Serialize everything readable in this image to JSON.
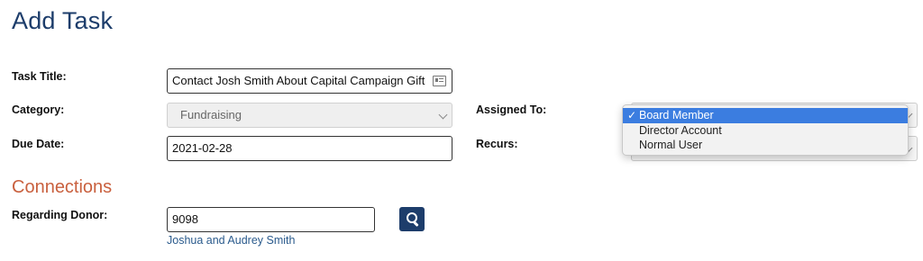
{
  "page": {
    "title": "Add Task"
  },
  "form": {
    "task_title": {
      "label": "Task Title:",
      "value": "Contact Josh Smith About Capital Campaign Gift",
      "icon": "contact-card-icon"
    },
    "category": {
      "label": "Category:",
      "value": "Fundraising",
      "disabled": true
    },
    "due_date": {
      "label": "Due Date:",
      "value": "2021-02-28"
    },
    "assigned_to": {
      "label": "Assigned To:",
      "selected": "Board Member",
      "check_mark": "✓",
      "options": [
        "Board Member",
        "Director Account",
        "Normal User"
      ]
    },
    "recurs": {
      "label": "Recurs:"
    }
  },
  "connections": {
    "heading": "Connections",
    "regarding_donor": {
      "label": "Regarding Donor:",
      "value": "9098",
      "search_icon": "search-icon",
      "donor_name": "Joshua and Audrey Smith"
    }
  },
  "colors": {
    "title": "#1d3d6b",
    "section_heading": "#c9603e",
    "button": "#1d3d6b",
    "link": "#2a5a8c",
    "dropdown_highlight": "#3b7de0"
  }
}
